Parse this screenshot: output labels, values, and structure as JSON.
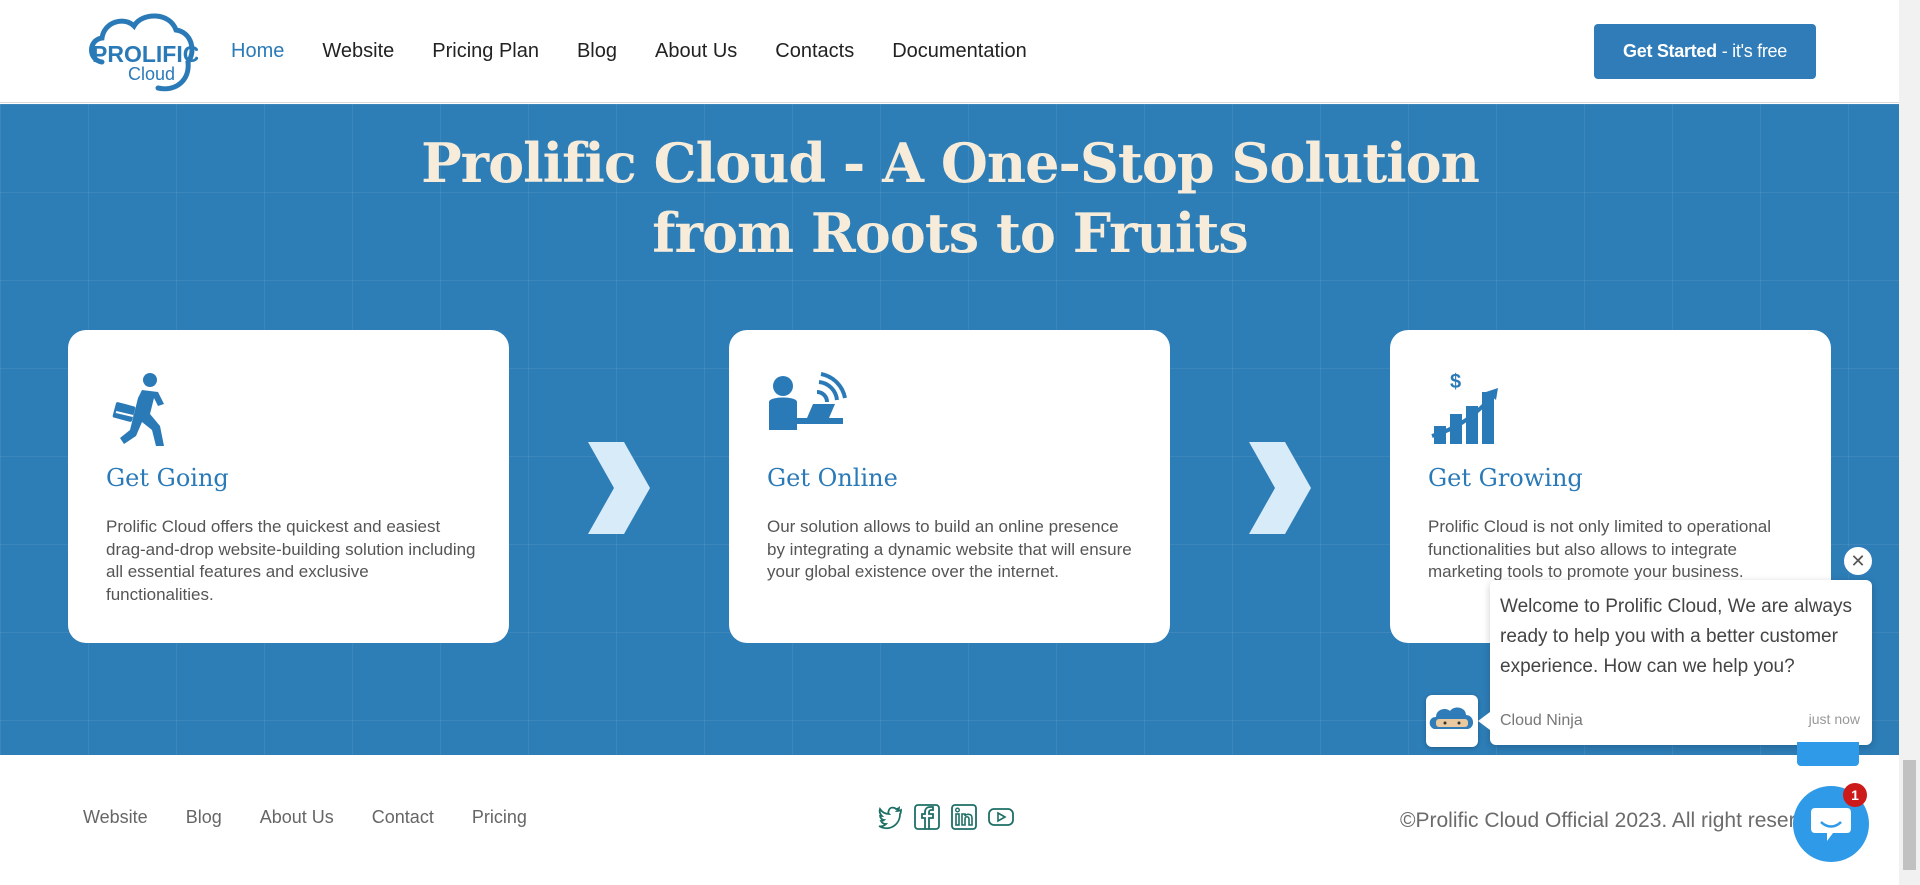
{
  "brand": {
    "logo_line1": "PROLIFIC",
    "logo_line2": "Cloud",
    "color": "#2b7ab8"
  },
  "nav": {
    "items": [
      {
        "label": "Home",
        "active": true
      },
      {
        "label": "Website"
      },
      {
        "label": "Pricing Plan"
      },
      {
        "label": "Blog"
      },
      {
        "label": "About Us"
      },
      {
        "label": "Contacts"
      },
      {
        "label": "Documentation"
      }
    ],
    "cta_bold": "Get Started",
    "cta_rest": "- it's free"
  },
  "hero": {
    "title_line1": "Prolific Cloud - A One-Stop Solution",
    "title_line2": "from Roots to Fruits",
    "background": "#2d7db7",
    "title_color": "#f6ecd9"
  },
  "cards": [
    {
      "icon": "running-businessman-icon",
      "title": "Get Going",
      "text": "Prolific Cloud offers the quickest and easiest drag-and-drop website-building solution including all essential features and exclusive functionalities."
    },
    {
      "icon": "online-user-icon",
      "title": "Get Online",
      "text": "Our solution allows to build an online presence by integrating a dynamic website that will ensure your global existence over the internet."
    },
    {
      "icon": "growth-chart-icon",
      "title": "Get Growing",
      "text": "Prolific Cloud is not only limited to operational functionalities but also allows to integrate marketing tools to promote your business."
    }
  ],
  "chat": {
    "message": "Welcome to Prolific Cloud, We are always ready to help you with a better customer experience. How can we help you?",
    "agent": "Cloud Ninja",
    "time": "just now",
    "close_icon": "close-icon",
    "unread_count": "1"
  },
  "footer": {
    "links": [
      "Website",
      "Blog",
      "About Us",
      "Contact",
      "Pricing"
    ],
    "socials": [
      "twitter-icon",
      "facebook-icon",
      "linkedin-icon",
      "youtube-icon"
    ],
    "copyright": "©Prolific Cloud Official 2023. All right reserve"
  }
}
